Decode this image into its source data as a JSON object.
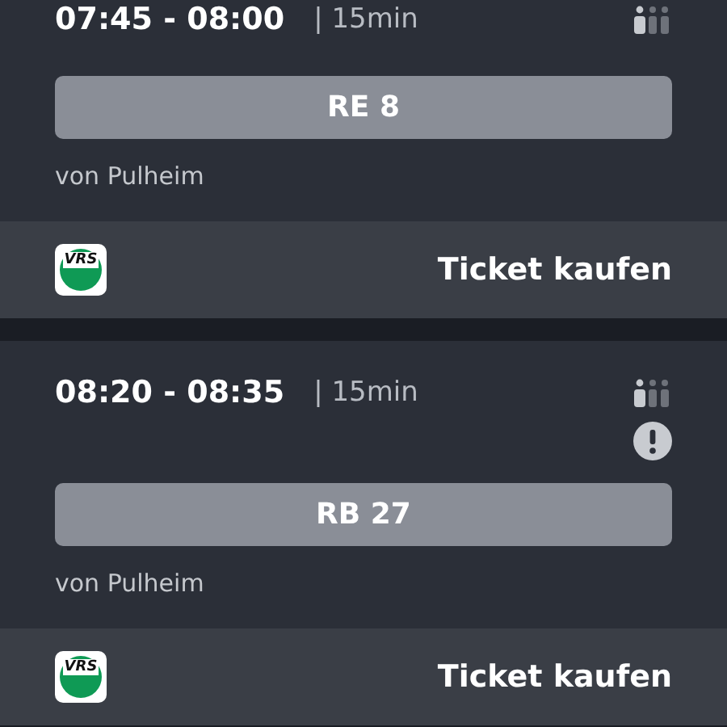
{
  "connections": [
    {
      "time": "07:45 - 08:00",
      "duration": "| 15min",
      "warning": false,
      "line": "RE 8",
      "origin": "von Pulheim",
      "logo": "VRS",
      "action": "Ticket kaufen"
    },
    {
      "time": "08:20 - 08:35",
      "duration": "| 15min",
      "warning": true,
      "line": "RB 27",
      "origin": "von Pulheim",
      "logo": "VRS",
      "action": "Ticket kaufen"
    }
  ]
}
